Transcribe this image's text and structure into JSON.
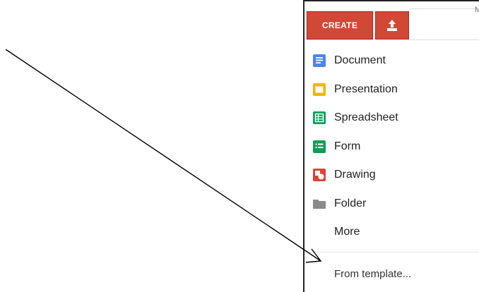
{
  "toolbar": {
    "create_label": "CREATE",
    "upload_icon": "upload-icon",
    "corner_text": "M"
  },
  "menu": {
    "items": [
      {
        "label": "Document",
        "icon": "document-icon",
        "color": "#4a86e8"
      },
      {
        "label": "Presentation",
        "icon": "presentation-icon",
        "color": "#f4b400"
      },
      {
        "label": "Spreadsheet",
        "icon": "spreadsheet-icon",
        "color": "#0f9d58"
      },
      {
        "label": "Form",
        "icon": "form-icon",
        "color": "#0f9d58"
      },
      {
        "label": "Drawing",
        "icon": "drawing-icon",
        "color": "#db4437"
      },
      {
        "label": "Folder",
        "icon": "folder-icon",
        "color": "#8a8a8a"
      },
      {
        "label": "More",
        "icon": "",
        "color": ""
      }
    ],
    "template_label": "From template..."
  },
  "colors": {
    "accent": "#d14836",
    "annotation": "#000000"
  }
}
